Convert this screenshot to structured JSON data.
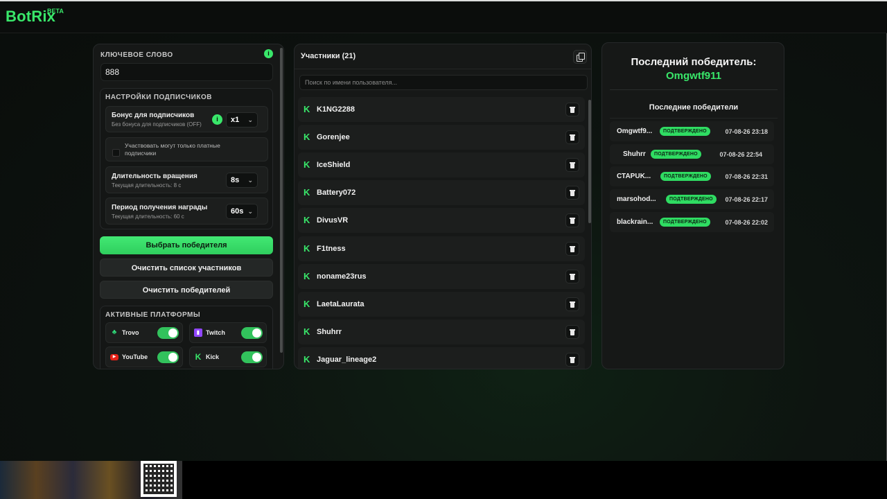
{
  "brand": {
    "name": "BotRix",
    "tag": "BETA"
  },
  "left": {
    "keyword_title": "КЛЮЧЕВОЕ СЛОВО",
    "keyword_value": "888",
    "subs_title": "НАСТРОЙКИ ПОДПИСЧИКОВ",
    "bonus_title": "Бонус для подписчиков",
    "bonus_sub": "Без бонуса для подписчиков (OFF)",
    "bonus_value": "x1",
    "paid_only": "Участвовать могут только платные подписчики",
    "spin_title": "Длительность вращения",
    "spin_sub": "Текущая длительность: 8 с",
    "spin_value": "8s",
    "reward_title": "Период получения награды",
    "reward_sub": "Текущая длительность: 60 с",
    "reward_value": "60s",
    "pick_winner": "Выбрать победителя",
    "clear_participants": "Очистить список участников",
    "clear_winners": "Очистить победителей",
    "platforms_title": "АКТИВНЫЕ ПЛАТФОРМЫ",
    "platforms": [
      {
        "name": "Trovo",
        "icon": "trovo-icon",
        "enabled": true
      },
      {
        "name": "Twitch",
        "icon": "twitch-icon",
        "enabled": true
      },
      {
        "name": "YouTube",
        "icon": "youtube-icon",
        "enabled": true
      },
      {
        "name": "Kick",
        "icon": "kick-icon",
        "enabled": true
      }
    ]
  },
  "participants": {
    "title": "Участники (21)",
    "search_placeholder": "Поиск по имени пользователя...",
    "items": [
      "K1NG2288",
      "Gorenjee",
      "IceShield",
      "Battery072",
      "DivusVR",
      "F1tness",
      "noname23rus",
      "LaetaLaurata",
      "Shuhrr",
      "Jaguar_lineage2"
    ]
  },
  "winners": {
    "last_title": "Последний победитель:",
    "last_name": "Omgwtf911",
    "recent_title": "Последние победители",
    "status_label": "ПОДТВЕРЖДЕНО",
    "items": [
      {
        "name": "Omgwtf9...",
        "time": "07-08-26 23:18"
      },
      {
        "name": "Shuhrr",
        "time": "07-08-26 22:54"
      },
      {
        "name": "СТАРUK...",
        "time": "07-08-26 22:31"
      },
      {
        "name": "marsohod...",
        "time": "07-08-26 22:17"
      },
      {
        "name": "blackrain...",
        "time": "07-08-26 22:02"
      }
    ]
  },
  "colors": {
    "accent": "#39e76a",
    "bg": "#0a0d0b",
    "panel": "#161817"
  }
}
